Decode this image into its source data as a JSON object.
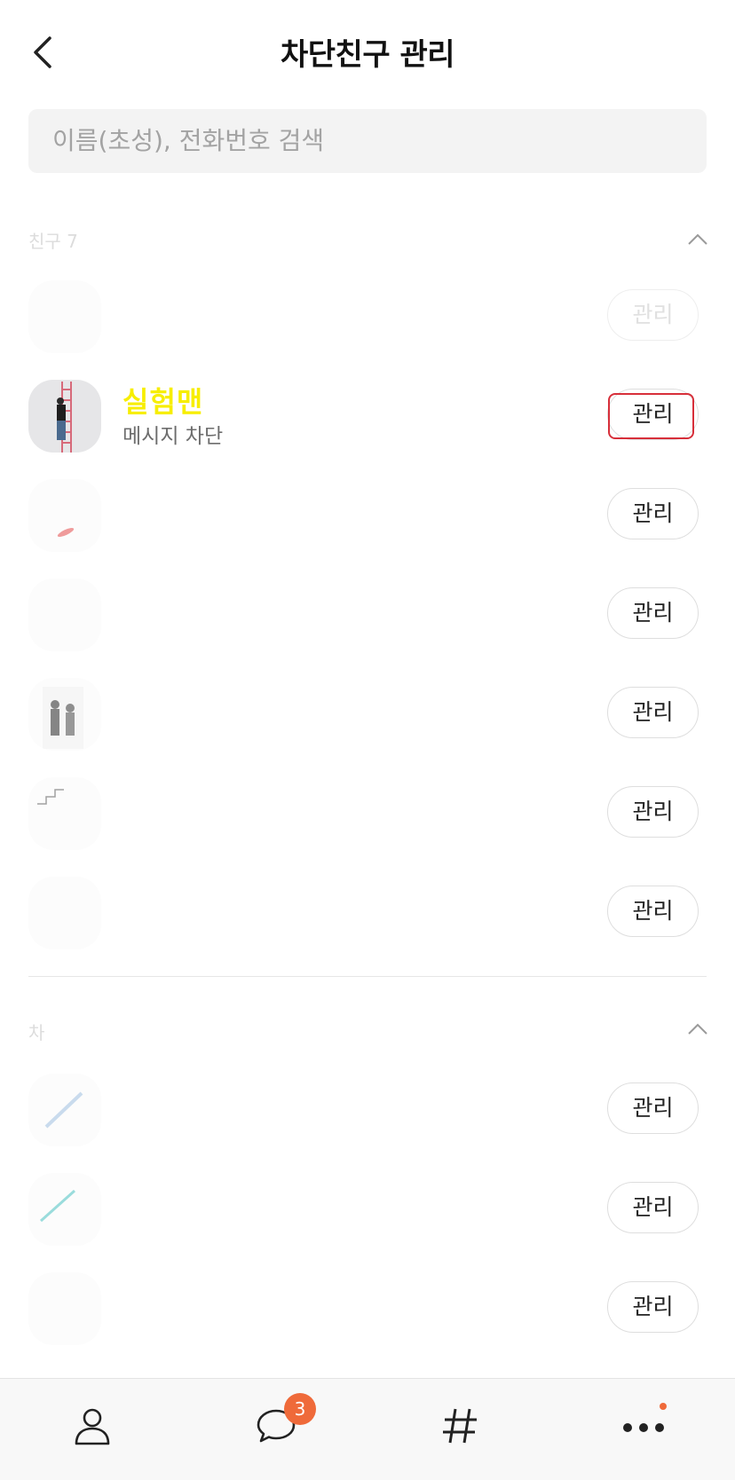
{
  "header": {
    "title": "차단친구 관리"
  },
  "search": {
    "placeholder": "이름(초성), 전화번호 검색"
  },
  "sections": [
    {
      "label": "친구 7"
    },
    {
      "label": "차"
    }
  ],
  "focused_row": {
    "name": "실험맨",
    "status": "메시지 차단"
  },
  "manage_label": "관리",
  "tabbar": {
    "chat_badge": "3"
  },
  "colors": {
    "accent": "#ef6a3a",
    "highlight_name": "#f7ee00",
    "focus_border": "#d72f3a"
  }
}
